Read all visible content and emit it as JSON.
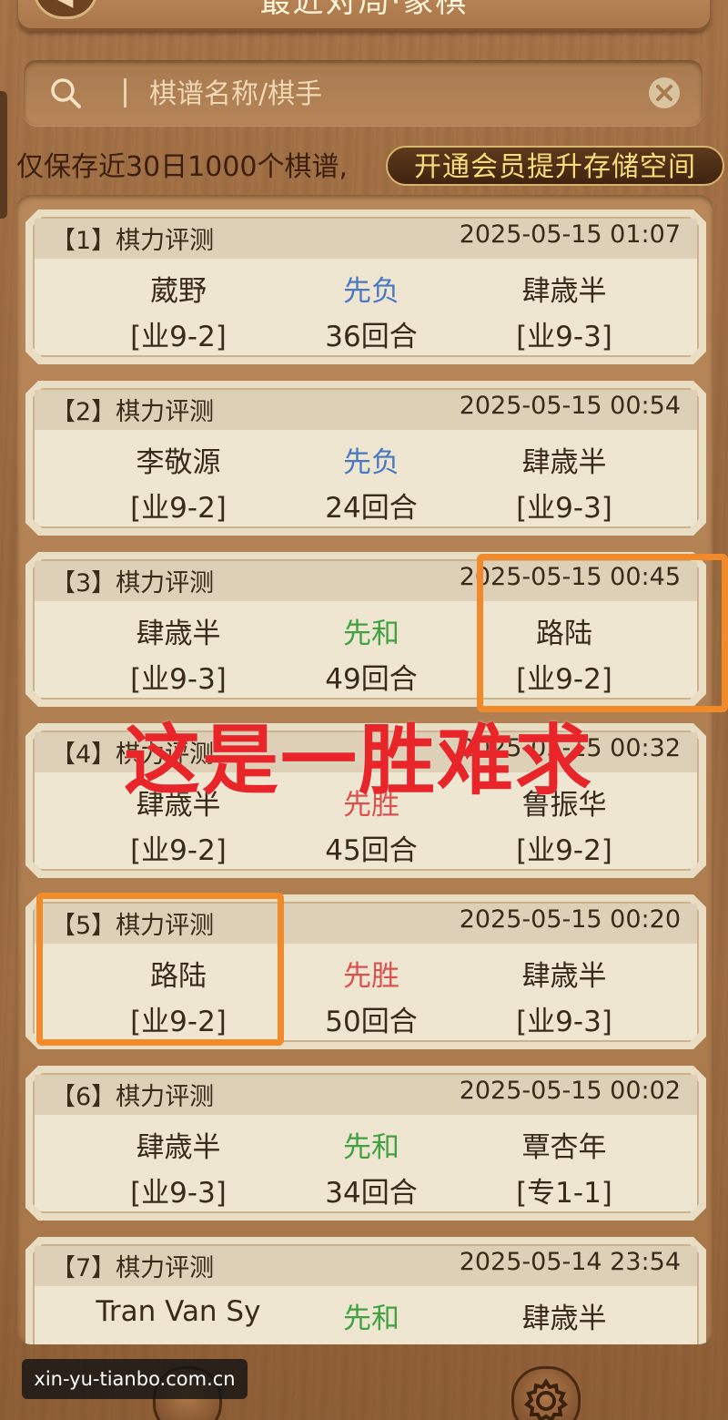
{
  "header": {
    "title": "最近对局·象棋",
    "back_glyph": "◀"
  },
  "search": {
    "placeholder": "棋谱名称/棋手",
    "value": ""
  },
  "notice": {
    "text": "仅保存近30日1000个棋谱,",
    "vip_label": "开通会员提升存储空间"
  },
  "colors": {
    "result_loss": "#4a78c4",
    "result_draw": "#3fa23f",
    "result_win": "#d9524f",
    "highlight": "#f08a2a",
    "caption": "#e8262a"
  },
  "records": [
    {
      "index": "【1】棋力评测",
      "time": "2025-05-15 01:07",
      "red_name": "葳野",
      "red_rank": "[业9-2]",
      "result": "先负",
      "result_type": "loss",
      "moves": "36回合",
      "black_name": "肆歳半",
      "black_rank": "[业9-3]"
    },
    {
      "index": "【2】棋力评测",
      "time": "2025-05-15 00:54",
      "red_name": "李敬源",
      "red_rank": "[业9-2]",
      "result": "先负",
      "result_type": "loss",
      "moves": "24回合",
      "black_name": "肆歳半",
      "black_rank": "[业9-3]"
    },
    {
      "index": "【3】棋力评测",
      "time": "2025-05-15 00:45",
      "red_name": "肆歳半",
      "red_rank": "[业9-3]",
      "result": "先和",
      "result_type": "draw",
      "moves": "49回合",
      "black_name": "路陆",
      "black_rank": "[业9-2]"
    },
    {
      "index": "【4】棋力评测",
      "time": "2025-05-15 00:32",
      "red_name": "肆歳半",
      "red_rank": "[业9-2]",
      "result": "先胜",
      "result_type": "win",
      "moves": "45回合",
      "black_name": "鲁振华",
      "black_rank": "[业9-2]"
    },
    {
      "index": "【5】棋力评测",
      "time": "2025-05-15 00:20",
      "red_name": "路陆",
      "red_rank": "[业9-2]",
      "result": "先胜",
      "result_type": "win",
      "moves": "50回合",
      "black_name": "肆歳半",
      "black_rank": "[业9-3]"
    },
    {
      "index": "【6】棋力评测",
      "time": "2025-05-15 00:02",
      "red_name": "肆歳半",
      "red_rank": "[业9-3]",
      "result": "先和",
      "result_type": "draw",
      "moves": "34回合",
      "black_name": "覃杏年",
      "black_rank": "[专1-1]"
    },
    {
      "index": "【7】棋力评测",
      "time": "2025-05-14 23:54",
      "red_name": "Tran Van Sy",
      "red_rank": "",
      "result": "先和",
      "result_type": "draw",
      "moves": "",
      "black_name": "肆歳半",
      "black_rank": ""
    }
  ],
  "overlay": {
    "caption": "这是一胜难求"
  },
  "watermark": {
    "text": "xin-yu-tianbo.com.cn"
  },
  "icons": {
    "search": "search-icon",
    "clear": "clear-icon",
    "settings": "gear-icon"
  }
}
